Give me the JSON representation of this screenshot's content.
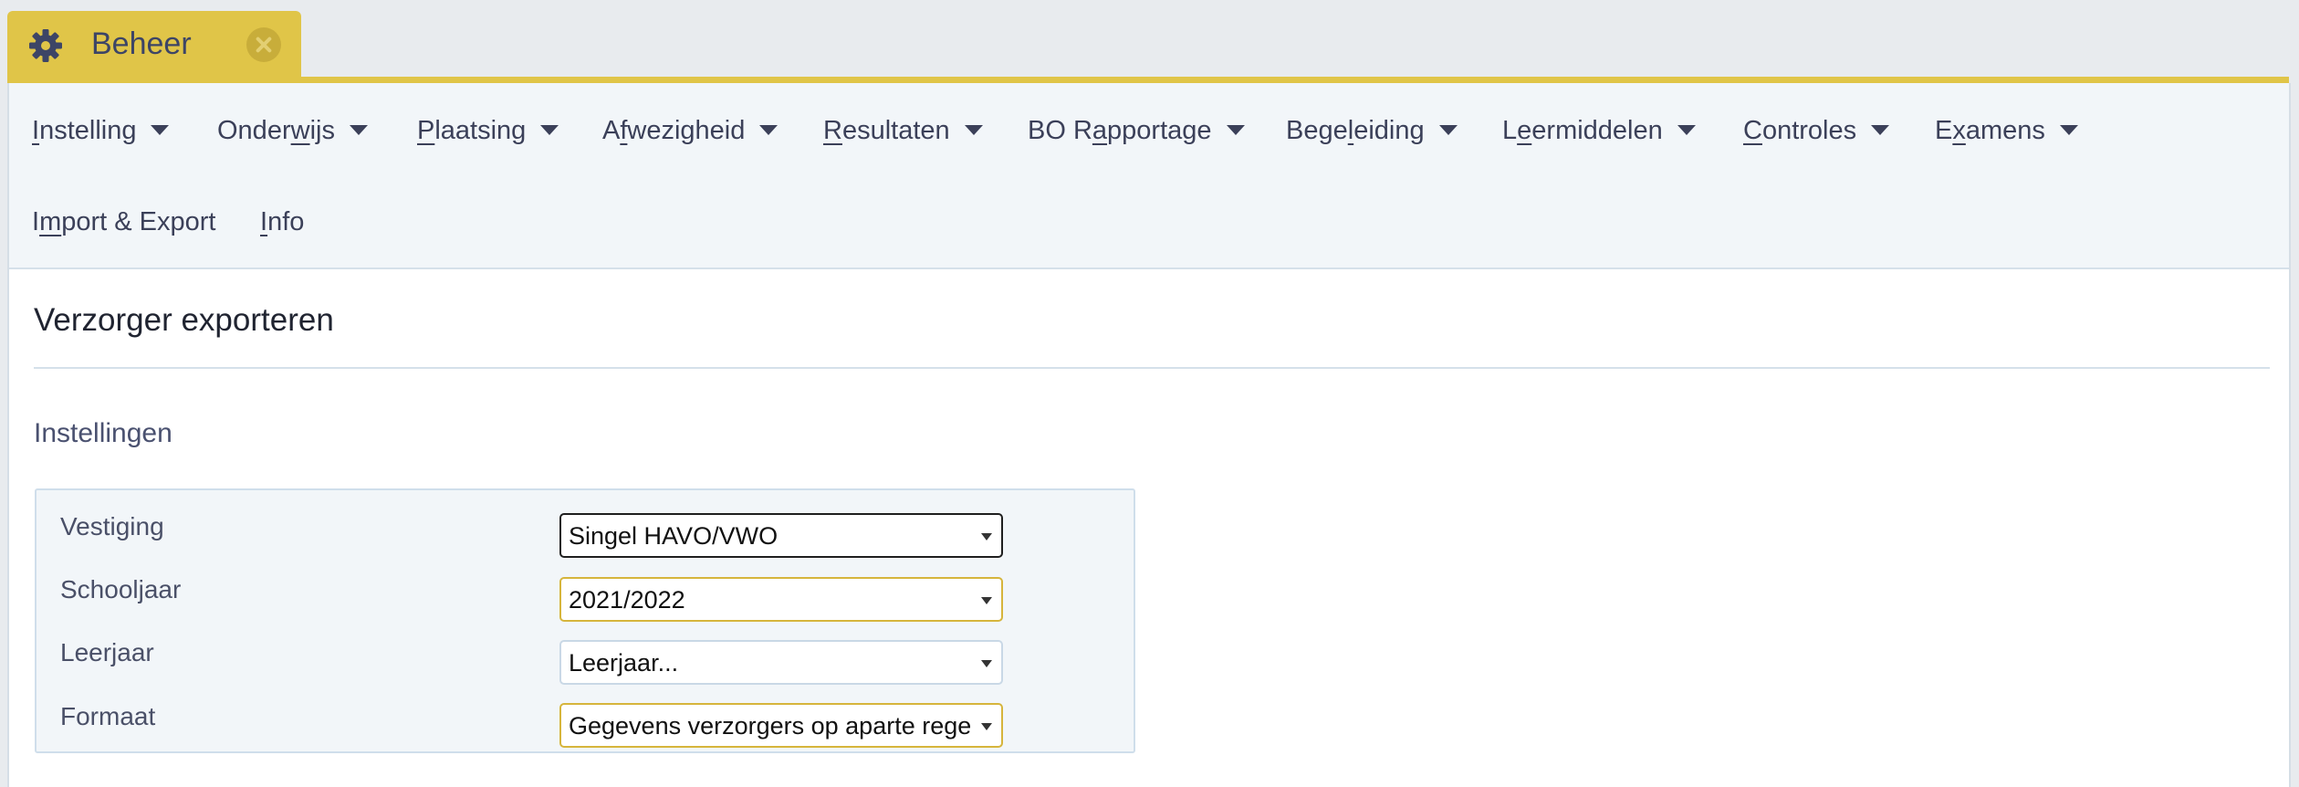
{
  "tab": {
    "title": "Beheer",
    "icon": "gear-icon",
    "close_icon": "close-icon"
  },
  "colors": {
    "accent": "#e0c548",
    "menu_bg": "#f2f6f9",
    "text": "#3b4059"
  },
  "menu": {
    "items": [
      {
        "pre": "",
        "u": "I",
        "post": "nstelling",
        "has_dropdown": true
      },
      {
        "pre": "Onder",
        "u": "w",
        "post": "ijs",
        "has_dropdown": true
      },
      {
        "pre": "",
        "u": "P",
        "post": "laatsing",
        "has_dropdown": true
      },
      {
        "pre": "A",
        "u": "f",
        "post": "wezigheid",
        "has_dropdown": true
      },
      {
        "pre": "",
        "u": "R",
        "post": "esultaten",
        "has_dropdown": true
      },
      {
        "pre": "BO R",
        "u": "a",
        "post": "pportage",
        "has_dropdown": true
      },
      {
        "pre": "Bege",
        "u": "l",
        "post": "eiding",
        "has_dropdown": true
      },
      {
        "pre": "L",
        "u": "e",
        "post": "ermiddelen",
        "has_dropdown": true
      },
      {
        "pre": "",
        "u": "C",
        "post": "ontroles",
        "has_dropdown": true
      },
      {
        "pre": "E",
        "u": "x",
        "post": "amens",
        "has_dropdown": true
      },
      {
        "pre": "I",
        "u": "m",
        "post": "port & Export",
        "has_dropdown": false
      },
      {
        "pre": "",
        "u": "I",
        "post": "nfo",
        "has_dropdown": false
      }
    ]
  },
  "page": {
    "title": "Verzorger exporteren",
    "section": "Instellingen"
  },
  "form": {
    "fields": [
      {
        "label": "Vestiging",
        "value": "Singel HAVO/VWO"
      },
      {
        "label": "Schooljaar",
        "value": "2021/2022"
      },
      {
        "label": "Leerjaar",
        "value": "Leerjaar..."
      },
      {
        "label": "Formaat",
        "value": "Gegevens verzorgers op aparte rege"
      }
    ]
  }
}
